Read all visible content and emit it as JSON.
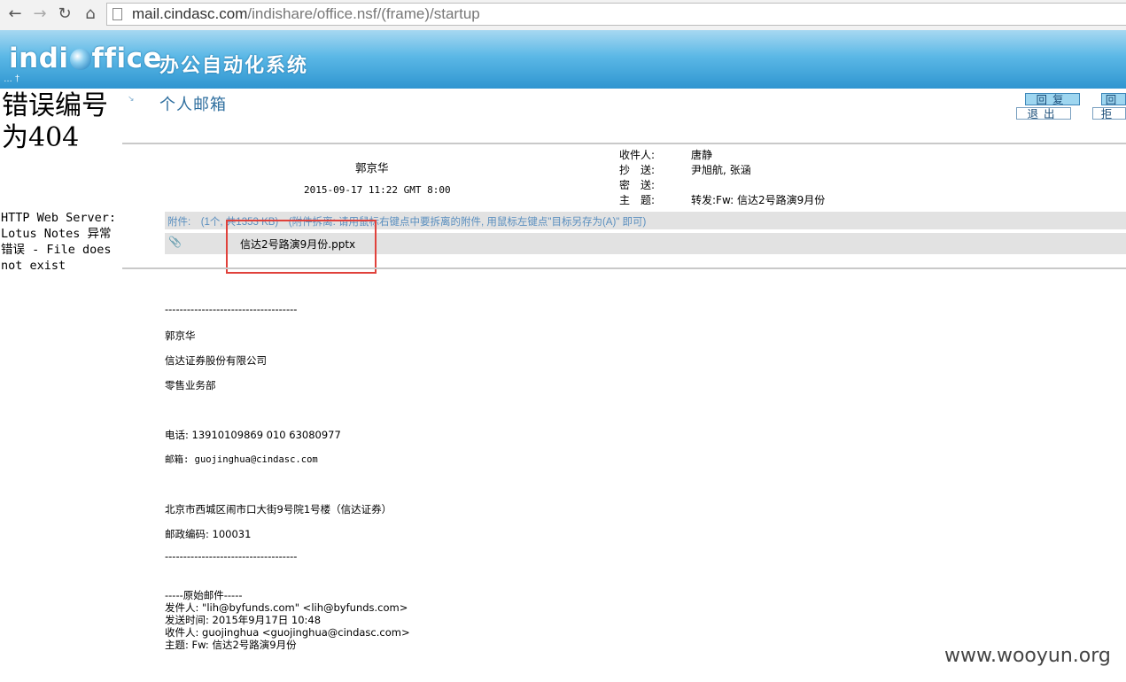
{
  "browser": {
    "url_host": "mail.cindasc.com",
    "url_path": "/indishare/office.nsf/(frame)/startup"
  },
  "banner": {
    "logo_left": "indi",
    "logo_right": "ffice",
    "subtitle": "办公自动化系统",
    "dots": "… †"
  },
  "error_frame": {
    "title": "错误编号为404",
    "message": "HTTP Web Server: Lotus Notes 异常错误 - File does not exist"
  },
  "mail": {
    "section_title": "个人邮箱",
    "buttons": {
      "reply": "回复",
      "reply2": "回",
      "exit": "退出",
      "reject": "拒"
    },
    "sender": "郭京华",
    "sent_date": "2015-09-17 11:22 GMT 8:00",
    "fields": {
      "to_label": "收件人:",
      "to_value": "唐静",
      "cc_label": "抄　送:",
      "cc_value": "尹旭航, 张涵",
      "bcc_label": "密　送:",
      "bcc_value": "",
      "subject_label": "主　题:",
      "subject_value": "转发:Fw: 信达2号路演9月份"
    },
    "attachment_info": "附件:　(1个, 共1353 KB)　(附件拆离: 请用鼠标右键点中要拆离的附件, 用鼠标左键点\"目标另存为(A)\" 即可)",
    "attachment_icon": "paperclip-icon",
    "attachment_file": "信达2号路演9月份.pptx",
    "body": {
      "separator": "------------------------------------",
      "name": "郭京华",
      "company": "信达证券股份有限公司",
      "dept": "零售业务部",
      "phone": "电话: 13910109869 010 63080977",
      "email": "邮箱: guojinghua@cindasc.com",
      "address": "北京市西城区闹市口大街9号院1号楼（信达证券）",
      "postcode": "邮政编码: 100031",
      "separator2": "------------------------------------",
      "orig_header": "-----原始邮件-----",
      "orig_from": "发件人: \"lih@byfunds.com\" <lih@byfunds.com>",
      "orig_time": "发送时间: 2015年9月17日 10:48",
      "orig_to": "收件人: guojinghua <guojinghua@cindasc.com>",
      "orig_subject": "主题: Fw: 信达2号路演9月份"
    }
  },
  "watermark": "www.wooyun.org",
  "colors": {
    "banner_top": "#a7d8f1",
    "banner_bottom": "#2f95d0",
    "title_blue": "#2f6f9f",
    "highlight_red": "#e0413b"
  }
}
